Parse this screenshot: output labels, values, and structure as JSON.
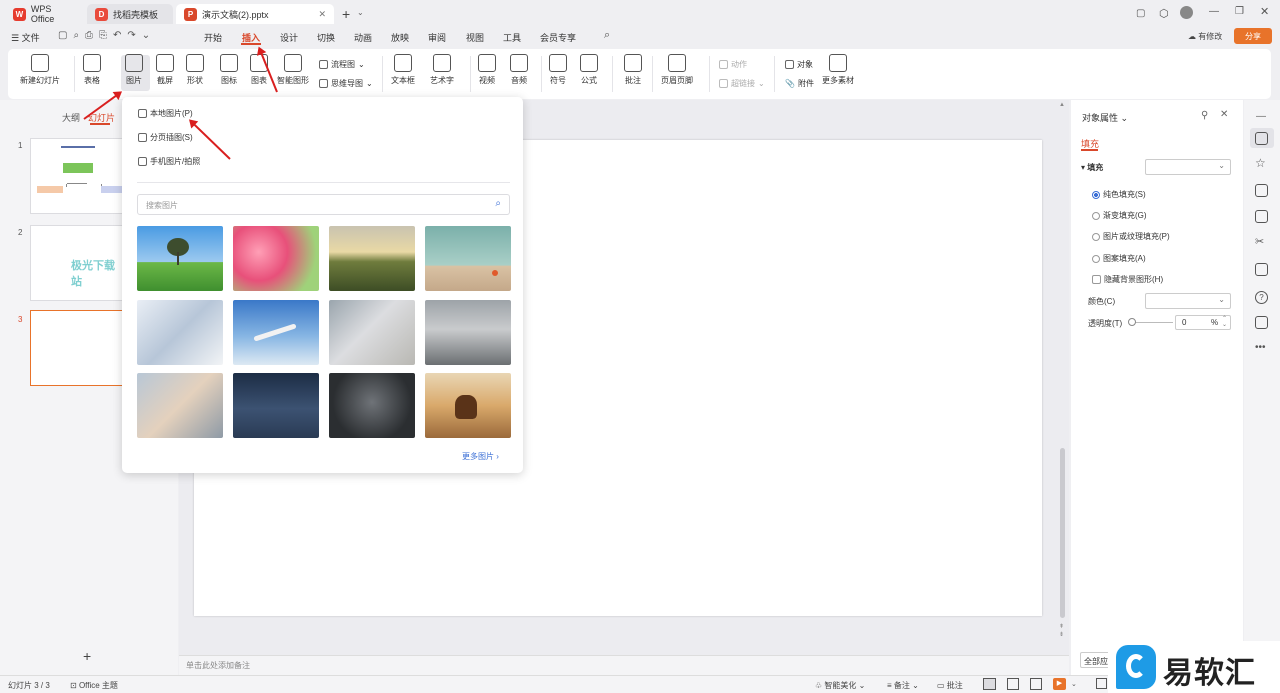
{
  "tabs": [
    {
      "label": "WPS Office"
    },
    {
      "label": "找稻壳模板"
    },
    {
      "label": "演示文稿(2).pptx"
    }
  ],
  "menu": {
    "file": "文件",
    "items": [
      "开始",
      "插入",
      "设计",
      "切换",
      "动画",
      "放映",
      "审阅",
      "视图",
      "工具",
      "会员专享"
    ],
    "has_edit": "有修改",
    "share": "分享"
  },
  "toolbar": {
    "new_slide": "新建幻灯片",
    "table": "表格",
    "picture": "图片",
    "screenshot": "截屏",
    "shape": "形状",
    "icon": "图标",
    "chart": "图表",
    "smart_shape": "智能图形",
    "flowchart": "流程图",
    "mindmap": "思维导图",
    "textbox": "文本框",
    "wordart": "艺术字",
    "video": "视频",
    "audio": "音频",
    "symbol": "符号",
    "formula": "公式",
    "comment": "批注",
    "header_footer": "页眉页脚",
    "action": "动作",
    "hyperlink": "超链接",
    "object": "对象",
    "attachment": "附件",
    "more_material": "更多素材"
  },
  "left_panel": {
    "outline_tab": "大纲",
    "slides_tab": "幻灯片",
    "slide_numbers": [
      "1",
      "2",
      "3"
    ],
    "slide2_text": "极光下载站",
    "add": "+"
  },
  "dropdown": {
    "local_picture": "本地图片(P)",
    "split_picture": "分页插图(S)",
    "phone_picture": "手机图片/拍照",
    "search_placeholder": "搜索图片",
    "more_pictures": "更多图片"
  },
  "notes_placeholder": "单击此处添加备注",
  "right_panel": {
    "title": "对象属性",
    "tab_fill": "填充",
    "fill_label": "填充",
    "options": [
      "纯色填充(S)",
      "渐变填充(G)",
      "图片或纹理填充(P)",
      "图案填充(A)"
    ],
    "hide_bg": "隐藏背景图形(H)",
    "color_label": "颜色(C)",
    "transparency_label": "透明度(T)",
    "transparency_value": "0",
    "percent": "%",
    "apply_all": "全部应"
  },
  "status": {
    "slide_count": "幻灯片 3 / 3",
    "theme": "Office 主题",
    "beautify": "智能美化",
    "notes": "备注",
    "comment": "批注"
  },
  "watermark": {
    "text": "易软汇"
  }
}
